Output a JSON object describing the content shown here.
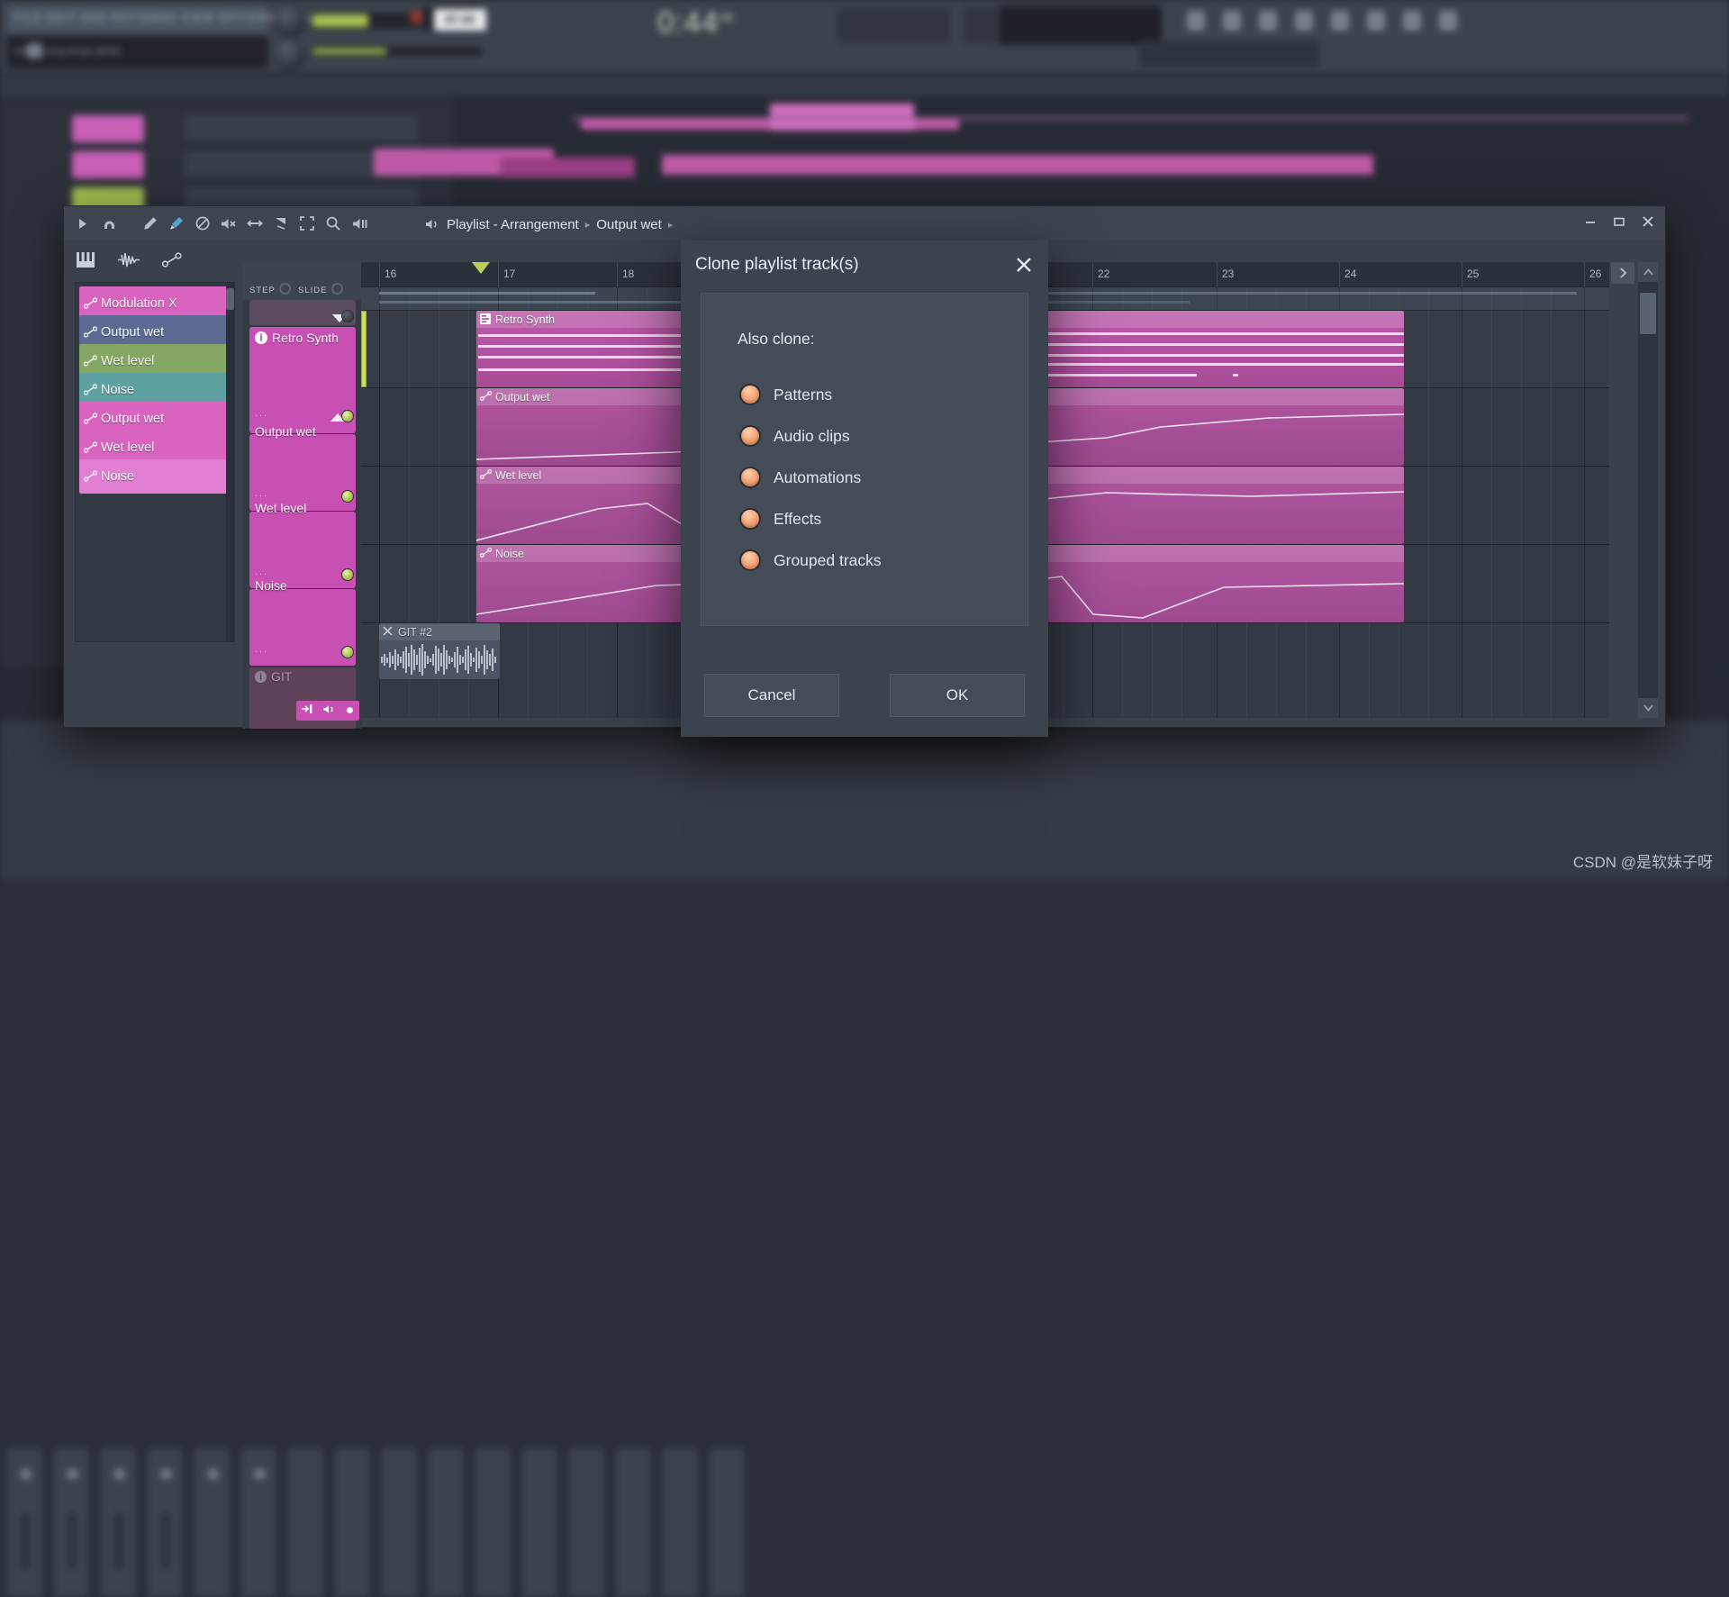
{
  "app": {
    "top_toolbar": {
      "menu_items": "FILE  EDIT  ADD  PATTERNS  VIEW  OPTIONS  TOOLS  HELP",
      "hint_text": "Set the song tempo (BPM)",
      "time_display": "0:44",
      "time_display_sub": "08",
      "bpm": "87.00",
      "pattern_name": "Retro Synth"
    }
  },
  "playlist_window": {
    "title": "Playlist - Arrangement",
    "breadcrumb_arrow": "▸",
    "selected_track": "Output wet",
    "toolbar_icons": [
      "play-triangle-icon",
      "magnet-snap-icon",
      "draw-pencil-icon",
      "paint-brush-icon",
      "delete-slash-icon",
      "mute-x-icon",
      "slip-arrows-icon",
      "slice-knife-icon",
      "select-frame-icon",
      "zoom-magnifier-icon",
      "playback-speaker-icon"
    ],
    "window_controls": [
      "minimize",
      "maximize",
      "close"
    ],
    "sub_toolbar_icons": [
      "piano-roll-icon",
      "audio-waveform-icon",
      "automation-clip-icon"
    ],
    "step_label": "STEP",
    "slide_label": "SLIDE",
    "track_names": [
      {
        "label": "Modulation X",
        "color": "#d864c0",
        "icon": "automation-icon"
      },
      {
        "label": "Output wet",
        "color": "#5b6b94",
        "icon": "automation-icon"
      },
      {
        "label": "Wet level",
        "color": "#84a763",
        "icon": "automation-icon"
      },
      {
        "label": "Noise",
        "color": "#5fa0a0",
        "icon": "automation-icon"
      },
      {
        "label": "Output wet",
        "color": "#d864c0",
        "icon": "automation-icon"
      },
      {
        "label": "Wet level",
        "color": "#d864c0",
        "icon": "automation-icon"
      },
      {
        "label": "Noise",
        "color": "#e07fd2",
        "icon": "automation-icon"
      }
    ],
    "track_headers": [
      {
        "label": "Retro Synth",
        "color": "#c850b4",
        "icon": "pattern-info-icon",
        "led": "on"
      },
      {
        "label": "Output wet",
        "color": "#c850b4",
        "icon": "",
        "led": "on"
      },
      {
        "label": "Wet level",
        "color": "#c850b4",
        "icon": "",
        "led": "on"
      },
      {
        "label": "Noise",
        "color": "#c850b4",
        "icon": "",
        "led": "on"
      },
      {
        "label": "GIT",
        "color": "#6b4a63",
        "icon": "pattern-info-icon",
        "led": "off"
      }
    ],
    "track_header_dots": "...",
    "git_buttons": [
      "route-to-mixer-icon",
      "solo-speaker-icon",
      "record-dot-icon"
    ],
    "ruler_bars": [
      "16",
      "17",
      "18",
      "22",
      "23",
      "24",
      "25",
      "26"
    ],
    "clips": [
      {
        "label": "Retro Synth",
        "icon": "pattern-icon"
      },
      {
        "label": "Output wet",
        "icon": "automation-icon"
      },
      {
        "label": "Wet level",
        "icon": "automation-icon"
      },
      {
        "label": "Noise",
        "icon": "automation-icon"
      },
      {
        "label": "GIT #2",
        "icon": "close-x-icon"
      }
    ]
  },
  "dialog": {
    "title": "Clone playlist track(s)",
    "close_icon": "close-x-icon",
    "subtitle": "Also clone:",
    "options": [
      {
        "label": "Patterns",
        "state": "on"
      },
      {
        "label": "Audio clips",
        "state": "on"
      },
      {
        "label": "Automations",
        "state": "on"
      },
      {
        "label": "Effects",
        "state": "on"
      },
      {
        "label": "Grouped tracks",
        "state": "on"
      }
    ],
    "cancel_label": "Cancel",
    "ok_label": "OK",
    "accent_color": "#f0a477"
  },
  "watermark": {
    "text": "CSDN @是软妹子呀"
  }
}
